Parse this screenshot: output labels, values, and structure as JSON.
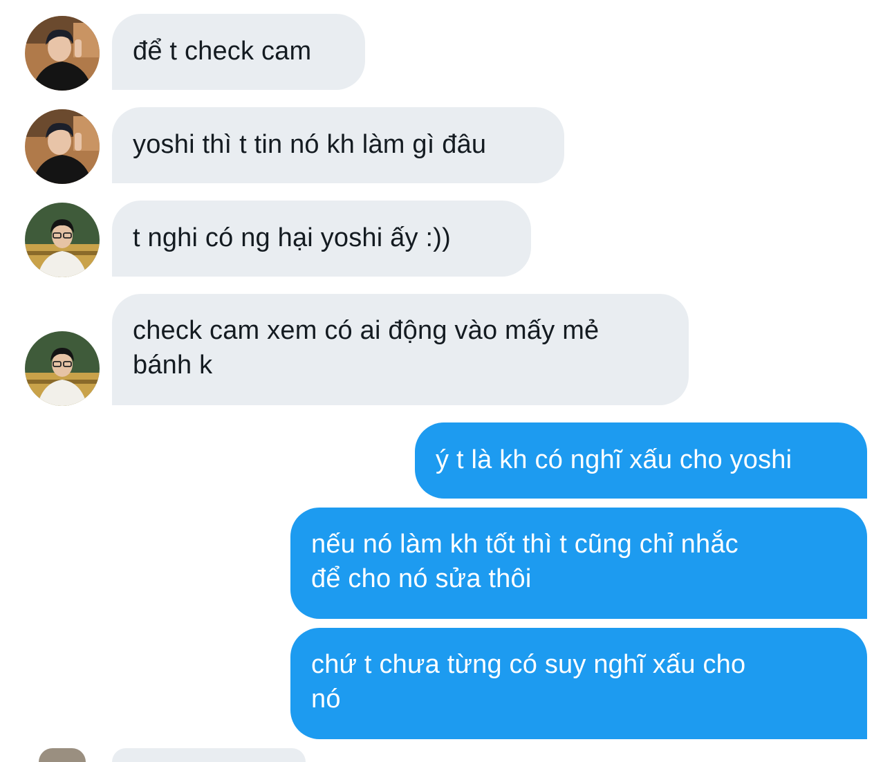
{
  "conversation": {
    "messages": [
      {
        "direction": "incoming",
        "sender_avatar": "avatar-black-shirt",
        "text": "để t check cam"
      },
      {
        "direction": "incoming",
        "sender_avatar": "avatar-black-shirt",
        "text": "yoshi thì t tin nó kh làm gì đâu"
      },
      {
        "direction": "incoming",
        "sender_avatar": "avatar-glasses-white-shirt",
        "text": "t nghi có ng hại yoshi ấy :))"
      },
      {
        "direction": "incoming",
        "sender_avatar": "avatar-glasses-white-shirt",
        "text": "check cam xem có ai động vào mấy mẻ\nbánh k"
      },
      {
        "direction": "outgoing",
        "text": "ý t là kh có nghĩ xấu cho yoshi"
      },
      {
        "direction": "outgoing",
        "text": "nếu nó làm kh tốt thì t cũng chỉ nhắc\nđể cho nó sửa thôi"
      },
      {
        "direction": "outgoing",
        "text": "chứ t chưa từng có suy nghĩ xấu cho\nnó"
      }
    ]
  },
  "colors": {
    "incoming_bubble": "#e9edf1",
    "incoming_text": "#141b21",
    "outgoing_bubble": "#1d9bf0",
    "outgoing_text": "#ffffff",
    "background": "#ffffff"
  }
}
